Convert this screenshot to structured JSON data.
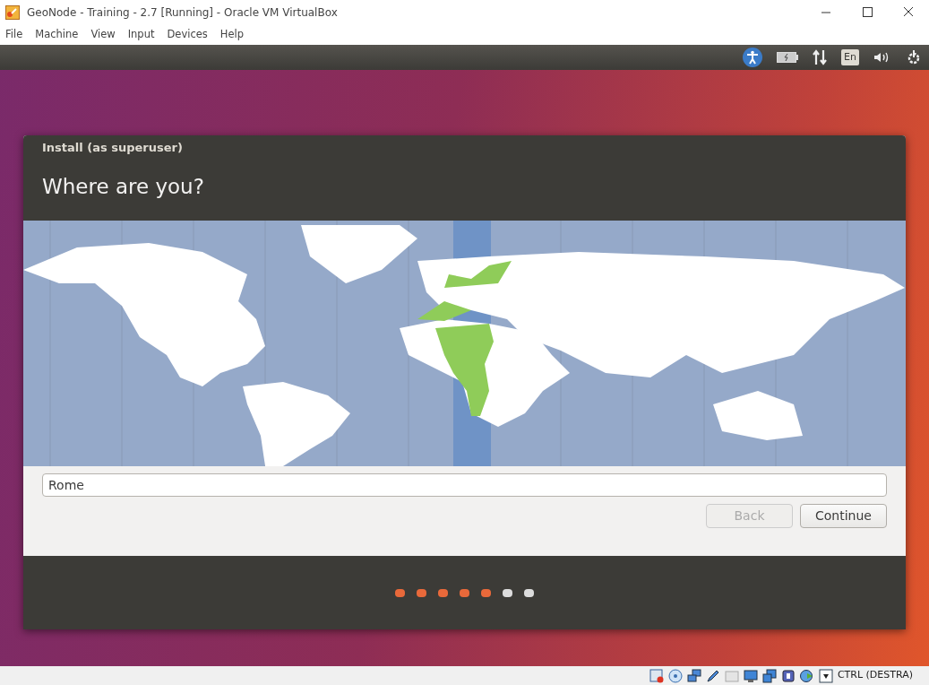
{
  "window": {
    "title": "GeoNode - Training - 2.7 [Running] - Oracle VM VirtualBox"
  },
  "menu": [
    "File",
    "Machine",
    "View",
    "Input",
    "Devices",
    "Help"
  ],
  "top_panel": {
    "keyboard_layout": "En"
  },
  "dialog": {
    "title": "Install (as superuser)",
    "heading": "Where are you?",
    "location_field": {
      "value": "Rome"
    },
    "buttons": [
      {
        "label": "Back",
        "disabled": true
      },
      {
        "label": "Continue",
        "disabled": false
      }
    ],
    "progress_dots": [
      {
        "done": true
      },
      {
        "done": true
      },
      {
        "done": true
      },
      {
        "done": true
      },
      {
        "done": true
      },
      {
        "done": false
      },
      {
        "done": false
      }
    ]
  },
  "status_bar": {
    "host_key": "CTRL (DESTRA)"
  }
}
